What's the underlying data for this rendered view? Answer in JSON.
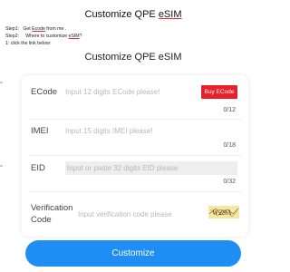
{
  "doc": {
    "title_prefix": "Customize QPE ",
    "title_underlined": "eSIM",
    "step1_prefix": "Step1:",
    "step1_text_a": "Get ",
    "step1_text_u": "Ecode",
    "step1_text_b": " from me .",
    "step2_prefix": "Step2:",
    "step2_text_a": "Where to customize ",
    "step2_text_u": "eSIM",
    "step2_text_b": "?",
    "step3_text": "1: click the link below:"
  },
  "form": {
    "title": "Customize QPE eSIM",
    "ecode": {
      "label": "ECode",
      "placeholder": "Input 12 digits ECode please!",
      "counter": "0/12",
      "buy_label": "Buy ECode"
    },
    "imei": {
      "label": "IMEI",
      "placeholder": "Input 15 digits IMEI please!",
      "counter": "0/18"
    },
    "eid": {
      "label": "EID",
      "placeholder": "Input or paste 32 digits EID please",
      "counter": "0/32"
    },
    "verification": {
      "label_line1": "Verification",
      "label_line2": "Code",
      "placeholder": "Input verification code please",
      "captcha_text": "WZ9A"
    },
    "submit_label": "Customize"
  },
  "colors": {
    "accent": "#1e8df4",
    "buy_button": "#e8202a",
    "captcha_bg": "#f3e9a4"
  }
}
